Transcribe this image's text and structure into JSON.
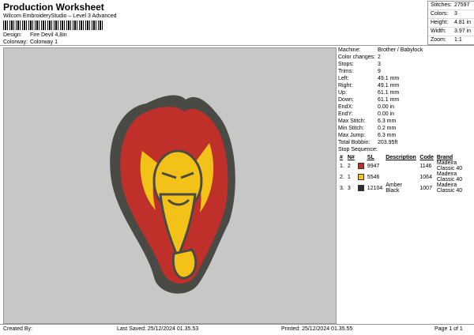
{
  "header": {
    "title": "Production Worksheet",
    "software": "Wilcom EmbroideryStudio – Level 3 Advanced",
    "design_label": "Design:",
    "design_value": "Fire Devil 4,8in",
    "colorway_label": "Colorway:",
    "colorway_value": "Colorway 1"
  },
  "stats": [
    {
      "label": "Stitches:",
      "value": "27597"
    },
    {
      "label": "Colors:",
      "value": "3"
    },
    {
      "label": "Height:",
      "value": "4.81 in"
    },
    {
      "label": "Width:",
      "value": "3.97 in"
    },
    {
      "label": "Zoom:",
      "value": "1:1"
    }
  ],
  "details": [
    {
      "label": "Machine:",
      "value": "Brother / Babylock"
    },
    {
      "label": "Color changes:",
      "value": "2"
    },
    {
      "label": "Stops:",
      "value": "3"
    },
    {
      "label": "Trims:",
      "value": "9"
    },
    {
      "label": "Left:",
      "value": "49.1 mm"
    },
    {
      "label": "Right:",
      "value": "49.1 mm"
    },
    {
      "label": "Up:",
      "value": "61.1 mm"
    },
    {
      "label": "Down:",
      "value": "61.1 mm"
    },
    {
      "label": "EndX:",
      "value": "0.00 in"
    },
    {
      "label": "EndY:",
      "value": "0.00 in"
    },
    {
      "label": "Max Stitch:",
      "value": "6.3 mm"
    },
    {
      "label": "Min Stitch:",
      "value": "0.2 mm"
    },
    {
      "label": "Max Jump:",
      "value": "6.3 mm"
    },
    {
      "label": "Total Bobbin:",
      "value": "203.95ft"
    }
  ],
  "sequence": {
    "title": "Stop Sequence:",
    "headers": {
      "num": "#",
      "n": "N#",
      "sl": "SL",
      "desc": "Description",
      "code": "Code",
      "brand": "Brand"
    },
    "rows": [
      {
        "num": "1.",
        "n": "2",
        "color": "#c0302a",
        "sl": "9947",
        "desc": "",
        "code": "1146",
        "brand": "Madeira Classic 40"
      },
      {
        "num": "2.",
        "n": "1",
        "color": "#f2c218",
        "sl": "5546",
        "desc": "",
        "code": "1064",
        "brand": "Madeira Classic 40"
      },
      {
        "num": "3.",
        "n": "3",
        "color": "#2b2b2b",
        "sl": "12104",
        "desc": "Amber Black",
        "code": "1007",
        "brand": "Madeira Classic 40"
      }
    ]
  },
  "footer": {
    "created_by": "Created By:",
    "last_saved": "Last Saved: 25/12/2024 01.35.53",
    "printed": "Printed: 25/12/2024 01.35.55",
    "page": "Page 1 of 1"
  },
  "colors": {
    "red": "#c0302a",
    "yellow": "#f2c218",
    "outline": "#4a4a44",
    "canvas": "#c7c7c7"
  }
}
